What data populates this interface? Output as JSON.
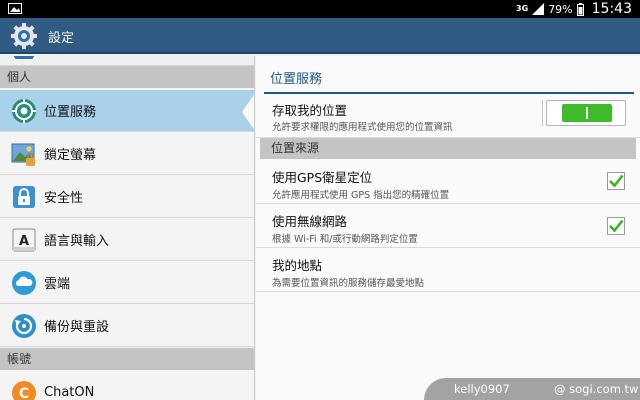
{
  "status_bar": {
    "network": "3G",
    "battery": "79%",
    "time": "15:43"
  },
  "action_bar": {
    "title": "設定",
    "icon": "gear-icon"
  },
  "sidebar": {
    "headers": [
      "個人",
      "帳號"
    ],
    "items": [
      {
        "label": "位置服務",
        "icon": "location-icon",
        "active": true
      },
      {
        "label": "鎖定螢幕",
        "icon": "lock-screen-icon"
      },
      {
        "label": "安全性",
        "icon": "security-lock-icon"
      },
      {
        "label": "語言與輸入",
        "icon": "language-icon"
      },
      {
        "label": "雲端",
        "icon": "cloud-icon"
      },
      {
        "label": "備份與重設",
        "icon": "backup-icon"
      },
      {
        "label": "ChatON",
        "icon": "chaton-icon"
      }
    ]
  },
  "main": {
    "title": "位置服務",
    "access_location": {
      "title": "存取我的位置",
      "summary": "允許要求權限的應用程式使用您的位置資訊",
      "enabled": true
    },
    "section_title": "位置來源",
    "prefs": [
      {
        "title": "使用GPS衛星定位",
        "summary": "允許應用程式使用 GPS 指出您的精確位置",
        "checked": true
      },
      {
        "title": "使用無線網路",
        "summary": "根據 Wi-Fi 和/或行動網路判定位置",
        "checked": true
      },
      {
        "title": "我的地點",
        "summary": "為需要位置資訊的服務儲存最愛地點"
      }
    ]
  },
  "watermark": {
    "user": "kelly0907",
    "site": "@ sogi.com.tw"
  },
  "colors": {
    "action_bar": "#2f5b85",
    "active_item": "#a9d1ea",
    "toggle_on": "#3fba2a",
    "check": "#3db22b",
    "accent_text": "#1a5a86"
  }
}
